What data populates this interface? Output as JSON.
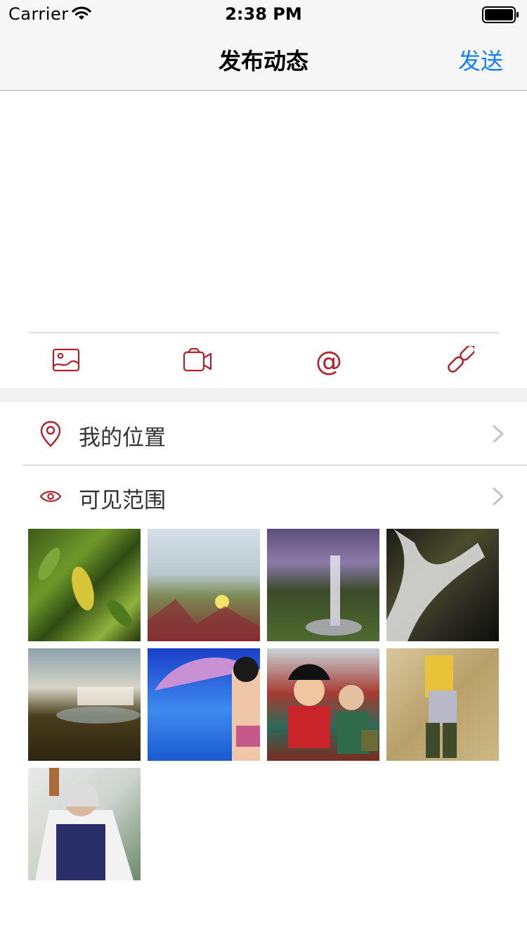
{
  "status_bar": {
    "carrier": "Carrier",
    "time": "2:38 PM"
  },
  "nav": {
    "title": "发布动态",
    "send_label": "发送"
  },
  "colors": {
    "accent": "#b3202a",
    "link_blue": "#147efb"
  },
  "toolbar": {
    "items": [
      {
        "icon": "image-icon"
      },
      {
        "icon": "video-camera-icon"
      },
      {
        "icon": "at-sign-icon",
        "glyph": "@"
      },
      {
        "icon": "link-icon"
      }
    ]
  },
  "rows": [
    {
      "label": "我的位置",
      "icon": "location-pin-icon"
    },
    {
      "label": "可见范围",
      "icon": "eye-icon"
    }
  ],
  "photos": [
    {
      "name": "photo-leaves"
    },
    {
      "name": "photo-flower-grass"
    },
    {
      "name": "photo-waterfall-purple"
    },
    {
      "name": "photo-waterfall-longexposure"
    },
    {
      "name": "photo-waterfall-cliff"
    },
    {
      "name": "photo-anime-umbrella"
    },
    {
      "name": "photo-anime-crew"
    },
    {
      "name": "photo-anime-map"
    },
    {
      "name": "photo-anime-oldman"
    }
  ]
}
